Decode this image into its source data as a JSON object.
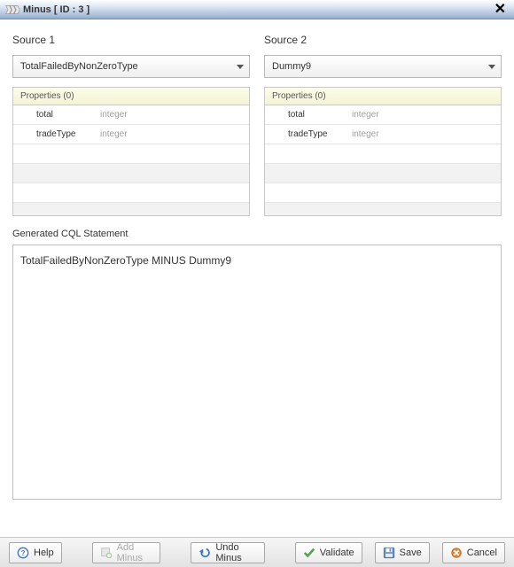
{
  "window": {
    "title": "Minus [ ID : 3 ]"
  },
  "sources": [
    {
      "label": "Source 1",
      "selected": "TotalFailedByNonZeroType",
      "properties_header": "Properties (0)",
      "properties": [
        {
          "name": "total",
          "type": "integer"
        },
        {
          "name": "tradeType",
          "type": "integer"
        }
      ]
    },
    {
      "label": "Source 2",
      "selected": "Dummy9",
      "properties_header": "Properties (0)",
      "properties": [
        {
          "name": "total",
          "type": "integer"
        },
        {
          "name": "tradeType",
          "type": "integer"
        }
      ]
    }
  ],
  "generated": {
    "label": "Generated CQL Statement",
    "text": "TotalFailedByNonZeroType MINUS Dummy9"
  },
  "footer": {
    "help": "Help",
    "add_minus": "Add Minus",
    "undo_minus": "Undo Minus",
    "validate": "Validate",
    "save": "Save",
    "cancel": "Cancel"
  }
}
